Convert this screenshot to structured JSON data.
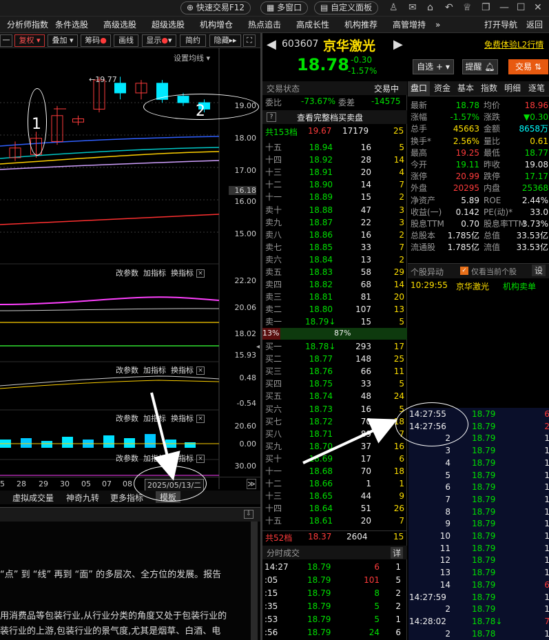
{
  "topbar": {
    "quick_trade": "快速交易F12",
    "multi_window": "多窗口",
    "custom_panel": "自定义面板"
  },
  "menu": {
    "items": [
      "分析师指数",
      "条件选股",
      "高级选股",
      "超级选股",
      "机构增仓",
      "热点追击",
      "高成长性",
      "机构推荐",
      "高管增持"
    ],
    "more": "»",
    "nav": "打开导航",
    "back": "返回"
  },
  "chart_toolbar": {
    "dash": "一",
    "fq": "复权",
    "overlay": "叠加",
    "chip": "筹码",
    "draw": "画线",
    "show": "显示",
    "simple": "简约",
    "hide": "隐藏"
  },
  "chart": {
    "ma_setting": "设置均线",
    "high_label": "19.77",
    "price_ticks": [
      "19.00",
      "18.00",
      "17.00",
      "16.18",
      "16.00",
      "15.00"
    ],
    "candles": [
      {
        "o": 17.3,
        "c": 17.6,
        "h": 17.8,
        "l": 17.2,
        "up": true
      },
      {
        "o": 17.4,
        "c": 17.9,
        "h": 18.1,
        "l": 17.3,
        "up": true
      },
      {
        "o": 17.8,
        "c": 18.6,
        "h": 18.9,
        "l": 17.7,
        "up": true
      },
      {
        "o": 18.4,
        "c": 18.5,
        "h": 18.6,
        "l": 18.3,
        "up": true
      },
      {
        "o": 18.8,
        "c": 19.7,
        "h": 19.8,
        "l": 18.7,
        "up": true
      },
      {
        "o": 19.6,
        "c": 19.3,
        "h": 19.8,
        "l": 19.1,
        "up": false
      },
      {
        "o": 19.3,
        "c": 19.6,
        "h": 19.7,
        "l": 19.1,
        "up": true
      },
      {
        "o": 19.6,
        "c": 19.1,
        "h": 19.7,
        "l": 19.0,
        "up": false
      },
      {
        "o": 19.2,
        "c": 19.0,
        "h": 19.3,
        "l": 18.9,
        "up": false
      },
      {
        "o": 19.0,
        "c": 18.8,
        "h": 19.1,
        "l": 18.7,
        "up": false
      }
    ],
    "ind_labels": {
      "modify": "改参数",
      "add": "加指标",
      "change": "换指标",
      "close": "×"
    },
    "panel2_ticks": [
      "22.20",
      "20.06",
      "18.02",
      "15.93"
    ],
    "panel3_ticks": [
      "0.48",
      "-0.54"
    ],
    "panel4_ticks": [
      "20.60",
      "0.00"
    ],
    "panel5_ticks": [
      "30.00"
    ],
    "x_dates": [
      "5",
      "28",
      "29",
      "30",
      "05",
      "07",
      "08"
    ],
    "date_box": "2025/05/13/二",
    "bottom_tabs": [
      "虚拟成交量",
      "神奇九转",
      "更多指标",
      "模板"
    ]
  },
  "news": {
    "line1": "“点” 到 “线” 再到 “面” 的多层次、全方位的发展。报告",
    "line2": "用消费品等包装行业,从行业分类的角度又处于包装行业的",
    "line3": "装行业的上游,包装行业的景气度,尤其是烟草、白酒、电"
  },
  "stock": {
    "code": "603607",
    "name": "京华激光",
    "price": "18.78",
    "change": "-0.30",
    "pct": "-1.57%",
    "free_l2": "免费体验L2行情",
    "add_watch": "自选 +",
    "alert": "提醒",
    "trade": "交易"
  },
  "orderbook": {
    "status": "交易状态",
    "status_val": "交易中",
    "wb_label": "委比",
    "wb": "-73.67%",
    "wc_label": "委差",
    "wc": "-14575",
    "view_all": "查看完整档买卖盘",
    "total_sell": "共153档",
    "ts_price": "19.67",
    "ts_vol": "17179",
    "ts_cnt": "25",
    "sells": [
      [
        "十五",
        "18.94",
        "16",
        "5"
      ],
      [
        "十四",
        "18.92",
        "28",
        "14"
      ],
      [
        "十三",
        "18.91",
        "20",
        "4"
      ],
      [
        "十二",
        "18.90",
        "14",
        "7"
      ],
      [
        "十一",
        "18.89",
        "15",
        "2"
      ],
      [
        "卖十",
        "18.88",
        "47",
        "3"
      ],
      [
        "卖九",
        "18.87",
        "22",
        "3"
      ],
      [
        "卖八",
        "18.86",
        "16",
        "2"
      ],
      [
        "卖七",
        "18.85",
        "33",
        "7"
      ],
      [
        "卖六",
        "18.84",
        "13",
        "2"
      ],
      [
        "卖五",
        "18.83",
        "58",
        "29"
      ],
      [
        "卖四",
        "18.82",
        "68",
        "14"
      ],
      [
        "卖三",
        "18.81",
        "81",
        "20"
      ],
      [
        "卖二",
        "18.80",
        "107",
        "13"
      ],
      [
        "卖一",
        "18.79↓",
        "15",
        "5"
      ]
    ],
    "ratio_left": "13%",
    "ratio_mid": "87%",
    "buys": [
      [
        "买一",
        "18.78↓",
        "293",
        "17"
      ],
      [
        "买二",
        "18.77",
        "148",
        "25"
      ],
      [
        "买三",
        "18.76",
        "66",
        "11"
      ],
      [
        "买四",
        "18.75",
        "33",
        "5"
      ],
      [
        "买五",
        "18.74",
        "48",
        "24"
      ],
      [
        "买六",
        "18.73",
        "16",
        "5"
      ],
      [
        "买七",
        "18.72",
        "70",
        "18"
      ],
      [
        "买八",
        "18.71",
        "89",
        "7"
      ],
      [
        "买九",
        "18.70",
        "37",
        "16"
      ],
      [
        "买十",
        "18.69",
        "17",
        "6"
      ],
      [
        "十一",
        "18.68",
        "70",
        "18"
      ],
      [
        "十二",
        "18.66",
        "1",
        "1"
      ],
      [
        "十三",
        "18.65",
        "44",
        "9"
      ],
      [
        "十四",
        "18.64",
        "51",
        "26"
      ],
      [
        "十五",
        "18.61",
        "20",
        "7"
      ]
    ],
    "total_buy": "共52档",
    "tb_price": "18.37",
    "tb_vol": "2604",
    "tb_cnt": "15"
  },
  "quote_tabs": [
    "盘口",
    "资金",
    "基本",
    "指数",
    "明细",
    "逐笔"
  ],
  "quote": [
    [
      "最新",
      "18.78",
      "均价",
      "18.96"
    ],
    [
      "涨幅",
      "-1.57%",
      "涨跌",
      "▼0.30"
    ],
    [
      "总手",
      "45663",
      "金额",
      "8658万"
    ],
    [
      "换手*",
      "2.56%",
      "量比",
      "0.61"
    ],
    [
      "最高",
      "19.25",
      "最低",
      "18.77"
    ],
    [
      "今开",
      "19.11",
      "昨收",
      "19.08"
    ],
    [
      "涨停",
      "20.99",
      "跌停",
      "17.17"
    ],
    [
      "外盘",
      "20295",
      "内盘",
      "25368"
    ],
    [
      "净资产",
      "5.89",
      "ROE",
      "2.44%"
    ],
    [
      "收益(一)",
      "0.142",
      "PE(动)*",
      "33.0"
    ],
    [
      "股息TTM",
      "0.70",
      "股息率TTM",
      "3.73%"
    ],
    [
      "总股本",
      "1.785亿",
      "总值",
      "33.53亿"
    ],
    [
      "流通股",
      "1.785亿",
      "流值",
      "33.53亿"
    ]
  ],
  "alerts": {
    "title": "个股异动",
    "only_current": "仅看当前个股",
    "setting": "设",
    "time": "10:29:55",
    "name": "京华激光",
    "event": "机构卖单"
  },
  "ticks": [
    [
      "14:27:55",
      "18.79",
      "6"
    ],
    [
      "14:27:56",
      "18.79",
      "2"
    ],
    [
      "2",
      "18.79",
      "1"
    ],
    [
      "3",
      "18.79",
      "1"
    ],
    [
      "4",
      "18.79",
      "1"
    ],
    [
      "5",
      "18.79",
      "1"
    ],
    [
      "6",
      "18.79",
      "1"
    ],
    [
      "7",
      "18.79",
      "1"
    ],
    [
      "8",
      "18.79",
      "1"
    ],
    [
      "9",
      "18.79",
      "1"
    ],
    [
      "10",
      "18.79",
      "1"
    ],
    [
      "11",
      "18.79",
      "1"
    ],
    [
      "12",
      "18.79",
      "1"
    ],
    [
      "13",
      "18.79",
      "1"
    ],
    [
      "14",
      "18.79",
      "6"
    ],
    [
      "14:27:59",
      "18.79",
      "1"
    ],
    [
      "2",
      "18.79",
      "1"
    ],
    [
      "14:28:02",
      "18.78↓",
      "7"
    ],
    [
      "2",
      "18.78",
      "1"
    ]
  ],
  "fenshi": {
    "title": "分时成交",
    "detail": "详",
    "rows": [
      [
        "14:27",
        "18.79",
        "6",
        "1"
      ],
      [
        ":05",
        "18.79",
        "101",
        "5"
      ],
      [
        ":15",
        "18.79",
        "8",
        "2"
      ],
      [
        ":35",
        "18.79",
        "5",
        "2"
      ],
      [
        ":53",
        "18.79",
        "5",
        "1"
      ],
      [
        ":56",
        "18.79",
        "24",
        "6"
      ]
    ]
  },
  "annotations": {
    "one": "1",
    "two": "2"
  }
}
